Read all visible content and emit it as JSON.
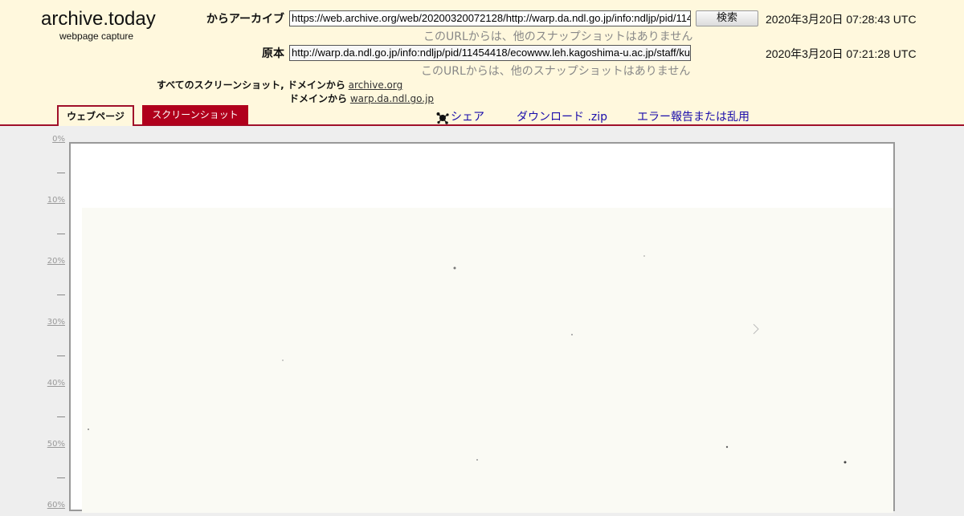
{
  "app": {
    "logo": "archive.today",
    "tagline": "webpage capture"
  },
  "archived": {
    "label": "からアーカイブ",
    "url": "https://web.archive.org/web/20200320072128/http://warp.da.ndl.go.jp/info:ndljp/pid/114",
    "timestamp": "2020年3月20日 07:28:43 UTC",
    "note": "このURLからは、他のスナップショットはありません",
    "search_label": "検索"
  },
  "original": {
    "label": "原本",
    "url": "http://warp.da.ndl.go.jp/info:ndljp/pid/11454418/ecowww.leh.kagoshima-u.ac.jp/staff/ku",
    "timestamp": "2020年3月20日 07:21:28 UTC",
    "note": "このURLからは、他のスナップショットはありません"
  },
  "screenshots": {
    "line1_prefix": "すべてのスクリーンショット, ドメインから",
    "line1_link": "archive.org",
    "line2_prefix": "ドメインから",
    "line2_link": "warp.da.ndl.go.jp"
  },
  "tabs": {
    "webpage": "ウェブページ",
    "screenshot": "スクリーンショット"
  },
  "actions": {
    "share": "シェア",
    "download": "ダウンロード .zip",
    "report": "エラー報告または乱用"
  },
  "ruler": [
    "0%",
    "10%",
    "20%",
    "30%",
    "40%",
    "50%",
    "60%"
  ]
}
